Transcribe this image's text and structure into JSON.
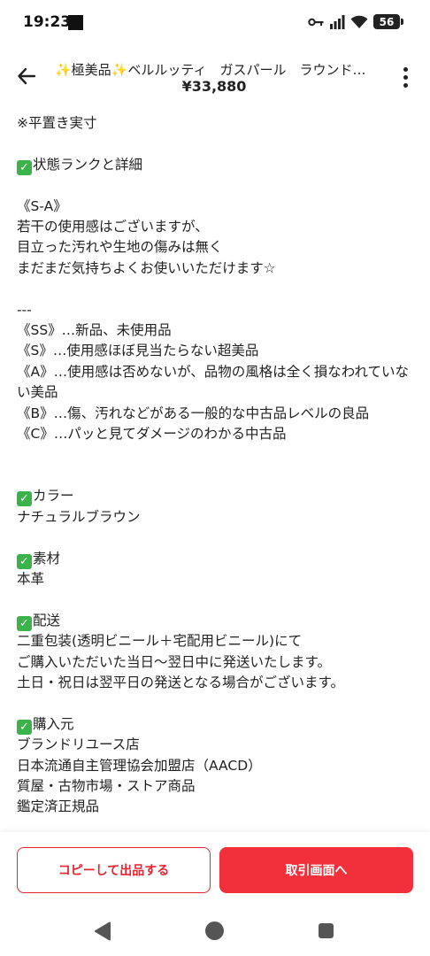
{
  "status_bar": {
    "time": "19:23",
    "battery": "56",
    "icons": [
      "key-icon",
      "signal-icon",
      "wifi-icon",
      "battery-icon"
    ]
  },
  "header": {
    "title": "✨極美品✨ベルルッティ　ガスパール　ラウンドジッ…",
    "price": "¥33,880"
  },
  "description": {
    "lines": [
      "※平置き実寸",
      "",
      "状態ランクと詳細",
      "",
      "《S-A》",
      "若干の使用感はございますが、",
      "目立った汚れや生地の傷みは無く",
      "まだまだ気持ちよくお使いいただけます☆",
      "",
      "---",
      "《SS》…新品、未使用品",
      "《S》…使用感ほぼ見当たらない超美品",
      "《A》…使用感は否めないが、品物の風格は全く損なわれていない美品",
      "《B》…傷、汚れなどがある一般的な中古品レベルの良品",
      "《C》…パッと見てダメージのわかる中古品",
      "",
      "",
      "カラー",
      "ナチュラルブラウン",
      "",
      "素材",
      "本革",
      "",
      "配送",
      "二重包装(透明ビニール＋宅配用ビニール)にて",
      "ご購入いただいた当日〜翌日中に発送いたします。",
      "土日・祝日は翌平日の発送となる場合がございます。",
      "",
      "購入元",
      "ブランドリユース店",
      "日本流通自主管理協会加盟店（AACD）",
      "質屋・古物市場・ストア商品",
      "鑑定済正規品"
    ],
    "checked_lines": [
      2,
      17,
      20,
      23,
      28
    ]
  },
  "actions": {
    "copy_label": "コピーして出品する",
    "trade_label": "取引画面へ"
  },
  "colors": {
    "accent": "#f2303c",
    "check": "#3bb24a"
  }
}
